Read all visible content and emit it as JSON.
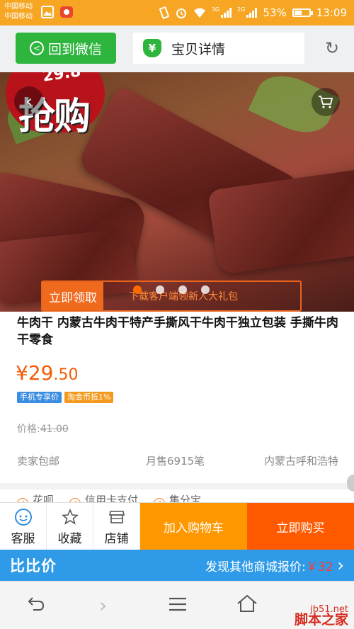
{
  "status_bar": {
    "carrier_1": "中国移动",
    "carrier_2": "中国移动",
    "network_1": "3G",
    "network_2": "2G",
    "battery": "53%",
    "battery_level": 0.53,
    "time": "13:09"
  },
  "top_nav": {
    "back_label": "回到微信",
    "title": "宝贝详情",
    "shield_glyph": "¥"
  },
  "hero": {
    "promo_price": "29.8",
    "promo_text": "抢购",
    "coupon_button": "立即领取",
    "coupon_text": "下载客户端领新人大礼包",
    "carousel_count": 4,
    "carousel_active": 0
  },
  "product": {
    "name": "牛肉干 内蒙古牛肉干特产手撕风干牛肉干独立包装 手撕牛肉干零食",
    "price_int": "¥29",
    "price_dec": ".50",
    "tags": [
      "手机专享价",
      "淘金币抵1%"
    ],
    "orig_label": "价格:",
    "orig_price": "41.00",
    "shipping": "卖家包邮",
    "monthly_sales": "月售6915笔",
    "location": "内蒙古呼和浩特",
    "services": [
      "花呗",
      "信用卡支付",
      "集分宝"
    ]
  },
  "actions": {
    "service": "客服",
    "favorite": "收藏",
    "shop": "店铺",
    "add_cart": "加入购物车",
    "buy_now": "立即购买"
  },
  "compare": {
    "logo": "比比价",
    "text": "发现其他商城报价:",
    "price": "￥32"
  },
  "watermark": {
    "site": "jb51.net",
    "name": "脚本之家"
  },
  "colors": {
    "status_bar": "#f6a623",
    "wechat_green": "#2db53d",
    "price_orange": "#f25c05",
    "cart_orange": "#ff9800",
    "buy_orange": "#ff5a00",
    "compare_blue": "#2f9be8"
  }
}
